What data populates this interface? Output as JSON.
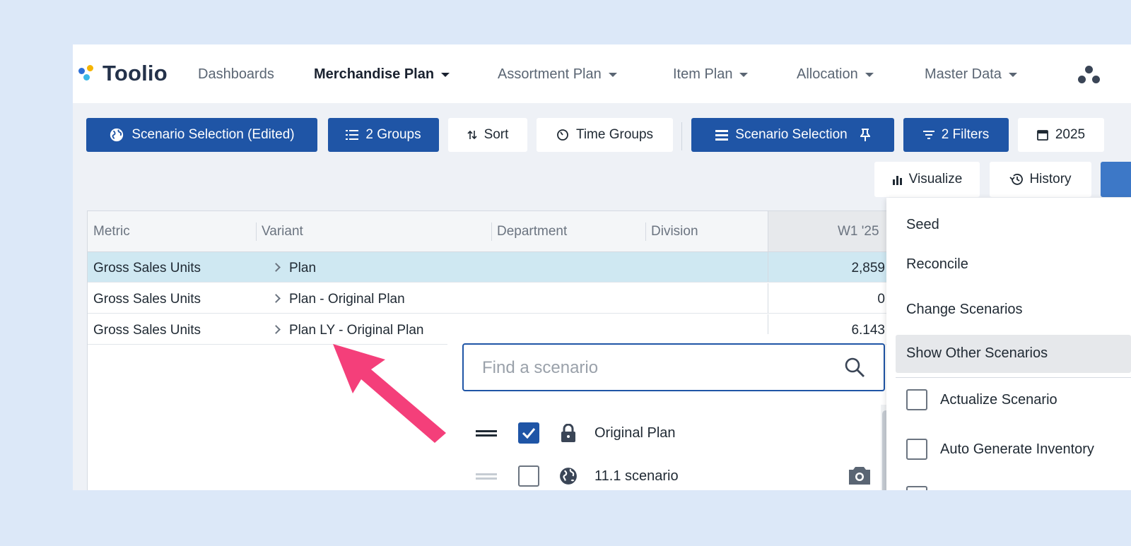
{
  "app": {
    "name": "Toolio",
    "brand_colors": [
      "#2d6fd6",
      "#f5b400",
      "#3bb8e8"
    ]
  },
  "nav": {
    "items": [
      {
        "label": "Dashboards",
        "dropdown": false,
        "active": false
      },
      {
        "label": "Merchandise Plan",
        "dropdown": true,
        "active": true
      },
      {
        "label": "Assortment Plan",
        "dropdown": true,
        "active": false
      },
      {
        "label": "Item Plan",
        "dropdown": true,
        "active": false
      },
      {
        "label": "Allocation",
        "dropdown": true,
        "active": false
      },
      {
        "label": "Master Data",
        "dropdown": true,
        "active": false
      }
    ]
  },
  "toolbar": {
    "scenario_edited": "Scenario Selection (Edited)",
    "groups": "2 Groups",
    "sort": "Sort",
    "time_groups": "Time Groups",
    "scenario_selection": "Scenario Selection",
    "filters": "2 Filters",
    "year": "2025",
    "visualize": "Visualize",
    "history": "History"
  },
  "grid": {
    "columns": [
      "Metric",
      "Variant",
      "Department",
      "Division",
      "W1 '25"
    ],
    "rows": [
      {
        "metric": "Gross Sales Units",
        "variant": "Plan",
        "department": "",
        "division": "",
        "w1": "2,859",
        "selected": true
      },
      {
        "metric": "Gross Sales Units",
        "variant": "Plan - Original Plan",
        "department": "",
        "division": "",
        "w1": "0",
        "selected": false
      },
      {
        "metric": "Gross Sales Units",
        "variant": "Plan LY - Original Plan",
        "department": "",
        "division": "",
        "w1": "6,143",
        "selected": false
      }
    ]
  },
  "scenario_picker": {
    "search_placeholder": "Find a scenario",
    "items": [
      {
        "label": "Original Plan",
        "checked": true,
        "icon": "lock-icon"
      },
      {
        "label": "11.1 scenario",
        "checked": false,
        "icon": "globe-icon"
      }
    ]
  },
  "actions_menu": {
    "items": [
      "Seed",
      "Reconcile",
      "Change Scenarios",
      "Show Other Scenarios"
    ],
    "highlighted": "Show Other Scenarios",
    "checkbox_items": [
      "Actualize Scenario",
      "Auto Generate Inventory"
    ]
  },
  "annotation": {
    "arrow_color": "#f43f7a"
  }
}
